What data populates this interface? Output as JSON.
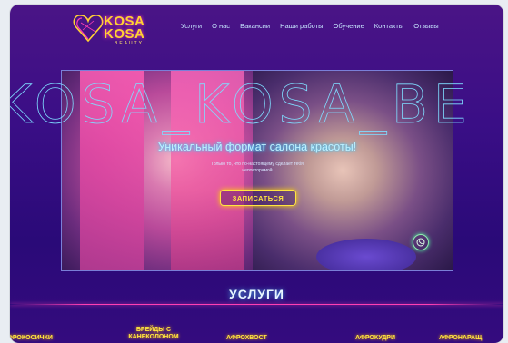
{
  "header": {
    "logo": {
      "line1": "KOSA",
      "line2": "KOSA",
      "line3": "BEAUTY"
    },
    "nav": [
      "Услуги",
      "О нас",
      "Вакансии",
      "Наши работы",
      "Обучение",
      "Контакты",
      "Отзывы"
    ]
  },
  "hero": {
    "background_text": "KOSA_KOSA_BE",
    "title": "Уникальный формат салона красоты!",
    "subtitle": "Только то, что по-настоящему сделает тебя неповторимой",
    "cta_label": "ЗАПИСАТЬСЯ"
  },
  "services": {
    "title": "УСЛУГИ",
    "items": [
      "АФРОКОСИЧКИ",
      "БРЕЙДЫ С КАНЕКОЛОНОМ",
      "АФРОХВОСТ",
      "АФРОКУДРИ",
      "АФРОНАРАЩ"
    ]
  },
  "colors": {
    "accent_yellow": "#ffe640",
    "accent_pink": "#ff3fb4",
    "accent_cyan": "#39c8ff",
    "bg_purple": "#3a0e86"
  }
}
